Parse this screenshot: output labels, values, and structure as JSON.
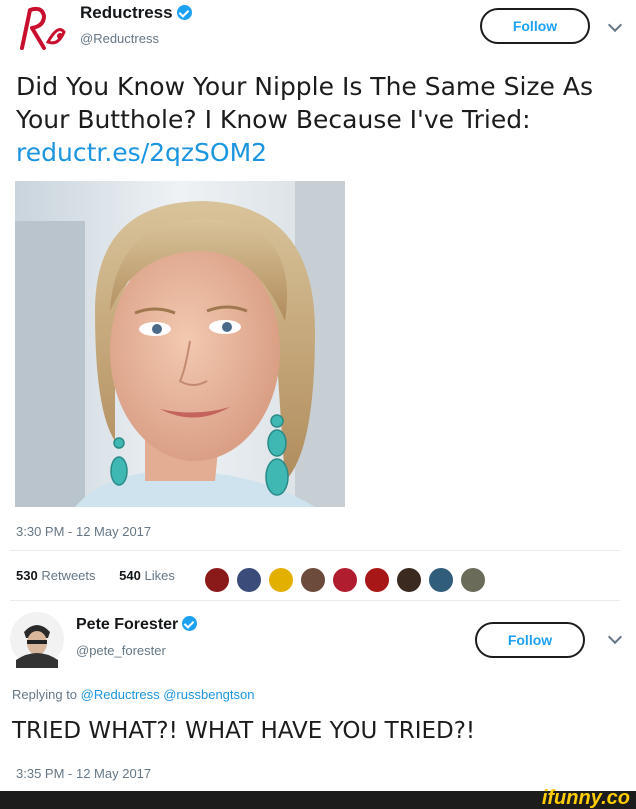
{
  "tweet": {
    "author_name": "Reductress",
    "author_handle": "@Reductress",
    "follow_label": "Follow",
    "text": "Did You Know Your Nipple Is The Same Size As Your Butthole? I Know Because I've Tried:",
    "link": "reductr.es/2qzSOM2",
    "timestamp": "3:30 PM - 12 May 2017",
    "retweets_count": "530",
    "retweets_label": "Retweets",
    "likes_count": "540",
    "likes_label": "Likes"
  },
  "reply": {
    "author_name": "Pete Forester",
    "author_handle": "@pete_forester",
    "follow_label": "Follow",
    "replying_prefix": "Replying to",
    "replying_mentions": "@Reductress @russbengtson",
    "text": "TRIED WHAT?! WHAT HAVE YOU TRIED?!",
    "timestamp": "3:35 PM - 12 May 2017"
  },
  "watermark": {
    "brand": "ifunny.co",
    "color": "#ffcc00"
  },
  "colors": {
    "link_blue": "#1b95e0",
    "verified_blue": "#1da1f2",
    "brand_red": "#c8102e",
    "muted_text": "#657786"
  },
  "liker_avatar_colors": [
    "#8a1a1a",
    "#3b4c7a",
    "#e2b000",
    "#6c4a3c",
    "#b01d2e",
    "#a81717",
    "#3a2a20",
    "#2f5d7a",
    "#6b6b5a"
  ]
}
